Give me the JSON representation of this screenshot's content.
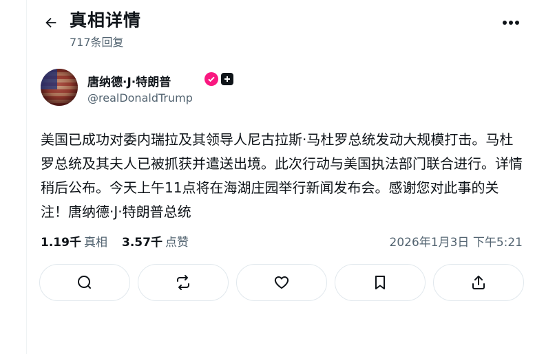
{
  "header": {
    "title": "真相详情",
    "reply_count": "717条回复"
  },
  "author": {
    "name": "唐纳德·J·特朗普",
    "handle": "@realDonaldTrump"
  },
  "post": {
    "text": "美国已成功对委内瑞拉及其领导人尼古拉斯·马杜罗总统发动大规模打击。马杜罗总统及其夫人已被抓获并遣送出境。此次行动与美国执法部门联合进行。详情稍后公布。今天上午11点将在海湖庄园举行新闻发布会。感谢您对此事的关注！唐纳德·J·特朗普总统"
  },
  "stats": {
    "retruths_value": "1.19千",
    "retruths_label": "真相",
    "likes_value": "3.57千",
    "likes_label": "点赞",
    "timestamp": "2026年1月3日 下午5:21"
  },
  "actions": [
    {
      "icon": "reply-icon"
    },
    {
      "icon": "repost-icon"
    },
    {
      "icon": "heart-icon"
    },
    {
      "icon": "bookmark-icon"
    },
    {
      "icon": "share-icon"
    }
  ],
  "colors": {
    "verified": "#f91880",
    "text": "#0f1419",
    "muted": "#536471"
  }
}
